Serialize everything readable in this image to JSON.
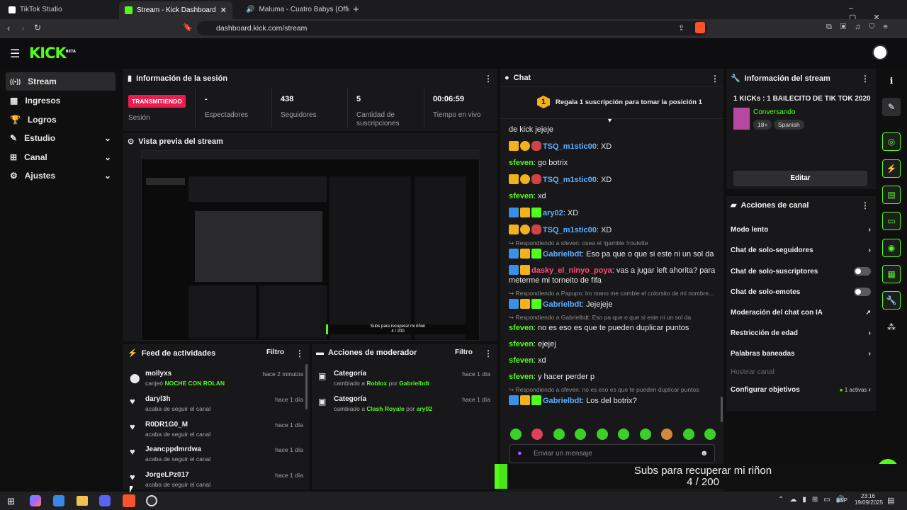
{
  "browser": {
    "tabs": [
      {
        "label": "TikTok Studio"
      },
      {
        "label": "Stream - Kick Dashboard"
      },
      {
        "label": "Maluma - Cuatro Babys (Official V"
      }
    ],
    "url": "dashboard.kick.com/stream"
  },
  "brand": {
    "logo": "KICK",
    "beta": "BETA"
  },
  "sidebar": {
    "items": [
      {
        "label": "Stream"
      },
      {
        "label": "Ingresos"
      },
      {
        "label": "Logros"
      },
      {
        "label": "Estudio"
      },
      {
        "label": "Canal"
      },
      {
        "label": "Ajustes"
      }
    ]
  },
  "session": {
    "title": "Información de la sesión",
    "badge": "TRANSMITIENDO",
    "badge_label": "Sesión",
    "stats": [
      {
        "value": "-",
        "label": "Espectadores"
      },
      {
        "value": "438",
        "label": "Seguidores"
      },
      {
        "value": "5",
        "label": "Cantidad de suscripciones"
      },
      {
        "value": "00:06:59",
        "label": "Tiempo en vivo"
      }
    ]
  },
  "preview": {
    "title": "Vista previa del stream"
  },
  "feed": {
    "title": "Feed de actividades",
    "filter": "Filtro",
    "rows": [
      {
        "name": "mollyxs",
        "time": "hace 2 minutos",
        "desc_prefix": "canjeó",
        "desc_highlight": "NOCHE CON ROLAN"
      },
      {
        "name": "daryl3h",
        "time": "hace 1 día",
        "desc": "acaba de seguir el canal"
      },
      {
        "name": "R0DR1G0_M",
        "time": "hace 1 día",
        "desc": "acaba de seguir el canal"
      },
      {
        "name": "Jeancppdmrdwa",
        "time": "hace 1 día",
        "desc": "acaba de seguir el canal"
      },
      {
        "name": "JorgeLPz017",
        "time": "hace 1 día",
        "desc": "acaba de seguir el canal"
      }
    ]
  },
  "modactions": {
    "title": "Acciones de moderador",
    "filter": "Filtro",
    "rows": [
      {
        "name": "Categoría",
        "time": "hace 1 día",
        "prefix": "cambiado a",
        "target": "Roblox",
        "by": "por",
        "user": "Gabrielbdt"
      },
      {
        "name": "Categoría",
        "time": "hace 1 día",
        "prefix": "cambiado a",
        "target": "Clash Royale",
        "by": "por",
        "user": "ary02"
      }
    ]
  },
  "chat": {
    "title": "Chat",
    "pinned_rank": "1",
    "pinned": "Regala 1 suscripción para tomar la posición 1",
    "lines": [
      {
        "text": "de kick jejeje"
      },
      {
        "user": "TSQ_m1stic00",
        "msg": "XD"
      },
      {
        "user": "sfeven",
        "msg": "go botrix"
      },
      {
        "user": "TSQ_m1stic00",
        "msg": "XD"
      },
      {
        "user": "sfeven",
        "msg": "xd"
      },
      {
        "user": "ary02",
        "msg": "XD"
      },
      {
        "user": "TSQ_m1stic00",
        "msg": "XD"
      },
      {
        "reply": "Respondiendo a sfeven: osea el !gamble !roulette"
      },
      {
        "user": "Gabrielbdt",
        "msg": "Eso pa que o que si este ni un sol da"
      },
      {
        "user": "dasky_el_ninyo_poya",
        "msg": "vas a jugar left ahorita? para meterme mi torneito de fifa"
      },
      {
        "reply": "Respondiendo a Papupn: Im mano me cambie el colorsito de mi nombre..."
      },
      {
        "user": "Gabrielbdt",
        "msg": "Jejejeje"
      },
      {
        "reply": "Respondiendo a Gabrielbdt: Eso pa que o que si este ni un sol da"
      },
      {
        "user": "sfeven",
        "msg": "no es eso es que te pueden duplicar puntos"
      },
      {
        "user": "sfeven",
        "msg": "ejejej"
      },
      {
        "user": "sfeven",
        "msg": "xd"
      },
      {
        "user": "sfeven",
        "msg": "y hacer perder p"
      },
      {
        "reply": "Respondiendo a sfeven: no es eso es que te pueden duplicar puntos"
      },
      {
        "user": "Gabrielbdt",
        "msg": "Los del botrix?"
      }
    ],
    "input_placeholder": "Enviar un mensaje"
  },
  "streaminfo": {
    "title": "Información del stream",
    "stream_title": "1 KICKs : 1 BAILECITO DE TIK TOK 2020",
    "category": "Conversando",
    "tags": [
      "18+",
      "Spanish"
    ],
    "edit": "Editar"
  },
  "channelactions": {
    "title": "Acciones de canal",
    "items": [
      {
        "label": "Modo lento",
        "kind": "chevron"
      },
      {
        "label": "Chat de solo-seguidores",
        "kind": "chevron"
      },
      {
        "label": "Chat de solo-suscriptores",
        "kind": "toggle"
      },
      {
        "label": "Chat de solo-emotes",
        "kind": "toggle"
      },
      {
        "label": "Moderación del chat con IA",
        "kind": "ext"
      },
      {
        "label": "Restricción de edad",
        "kind": "chevron"
      },
      {
        "label": "Palabras baneadas",
        "kind": "chevron"
      },
      {
        "label": "Hostear canal",
        "kind": "disabled"
      },
      {
        "label": "Configurar objetivos",
        "kind": "chevron",
        "note": "1 activas"
      }
    ]
  },
  "goal": {
    "title": "Subs para recuperar mi riñon",
    "progress_text": "4 / 200",
    "current": 4,
    "target": 200
  },
  "taskbar": {
    "lang": "ESP",
    "time": "23:16",
    "date": "19/09/2025"
  },
  "colors": {
    "brand": "#53fc18",
    "live": "#e91e4f",
    "panel": "#18181a"
  }
}
